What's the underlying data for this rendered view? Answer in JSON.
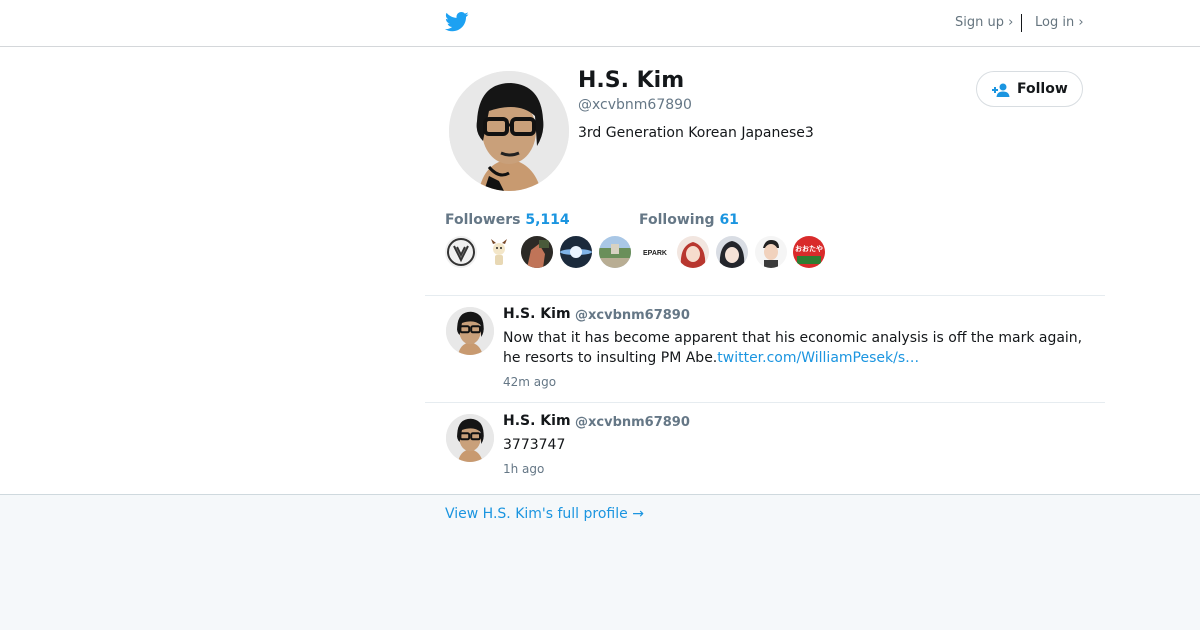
{
  "header": {
    "logo_icon": "twitter-bird-icon",
    "signup_label": "Sign up ›",
    "login_label": "Log in ›"
  },
  "profile": {
    "name": "H.S. Kim",
    "handle": "@xcvbnm67890",
    "bio": "3rd Generation Korean Japanese3",
    "follow_label": "Follow",
    "followers_label": "Followers",
    "followers_count": "5,114",
    "following_label": "Following",
    "following_count": "61",
    "follower_thumbs": [
      "emblem",
      "cartoon-dog",
      "hand-photo",
      "light-burst",
      "park-photo"
    ],
    "following_thumbs": [
      "epark-logo",
      "anime-girl-red",
      "anime-girl-dark",
      "cartoon-man",
      "red-logo"
    ],
    "follower_logo_text": "EPARK",
    "red_logo_text": "おおたや"
  },
  "tweets": [
    {
      "name": "H.S. Kim",
      "handle": "@xcvbnm67890",
      "text": "Now that it has become apparent that his economic analysis is off the mark again, he resorts to insulting PM Abe.",
      "link": "twitter.com/WilliamPesek/s…",
      "time": "42m ago"
    },
    {
      "name": "H.S. Kim",
      "handle": "@xcvbnm67890",
      "text": "3773747",
      "link": "",
      "time": "1h ago"
    }
  ],
  "footer": {
    "view_profile_label": "View H.S. Kim's full profile →"
  },
  "colors": {
    "accent": "#1b95e0",
    "logo": "#1da1f2",
    "text_muted": "#657786",
    "background": "#f5f8fa"
  }
}
